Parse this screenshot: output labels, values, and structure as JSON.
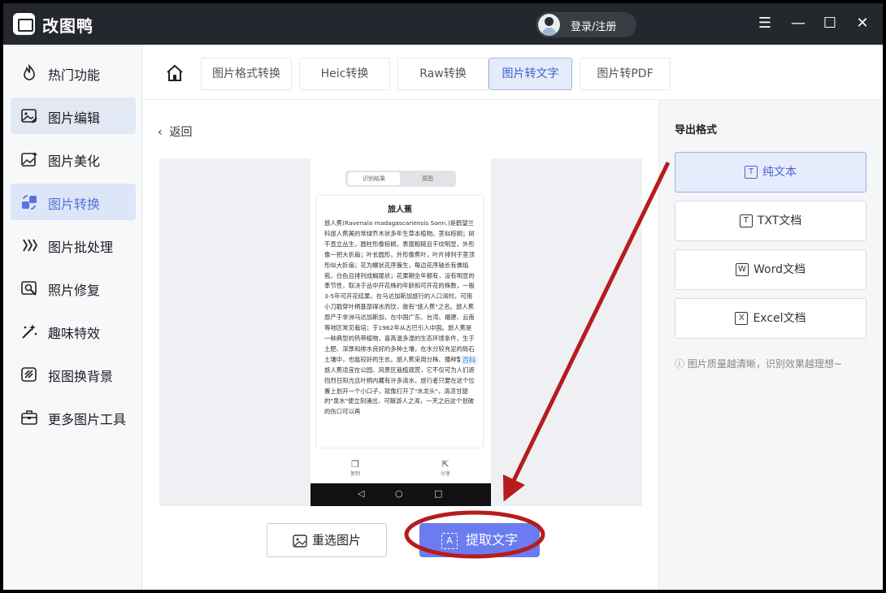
{
  "app": {
    "title": "改图鸭",
    "login_label": "登录/注册"
  },
  "window_controls": {
    "menu": "☰",
    "minimize": "—",
    "maximize": "☐",
    "close": "✕"
  },
  "sidebar": {
    "items": [
      {
        "label": "热门功能",
        "icon": "flame-icon"
      },
      {
        "label": "图片编辑",
        "icon": "image-edit-icon"
      },
      {
        "label": "图片美化",
        "icon": "image-beautify-icon"
      },
      {
        "label": "图片转换",
        "icon": "convert-icon"
      },
      {
        "label": "图片批处理",
        "icon": "batch-icon"
      },
      {
        "label": "照片修复",
        "icon": "repair-icon"
      },
      {
        "label": "趣味特效",
        "icon": "magic-wand-icon"
      },
      {
        "label": "抠图换背景",
        "icon": "cutout-icon"
      },
      {
        "label": "更多图片工具",
        "icon": "toolbox-icon"
      }
    ]
  },
  "tabs": [
    {
      "label": "图片格式转换"
    },
    {
      "label": "Heic转换"
    },
    {
      "label": "Raw转换"
    },
    {
      "label": "图片转文字",
      "active": true
    },
    {
      "label": "图片转PDF"
    }
  ],
  "main": {
    "back_label": "返回",
    "reselect_label": "重选图片",
    "extract_label": "提取文字",
    "extract_icon_text": "A"
  },
  "phone": {
    "tab_result": "识别结果",
    "tab_original": "原图",
    "doc_title": "旅人蕉",
    "doc_body": "旅人蕉(Ravenala madagascariensis Sonn.)是鹤望兰科旅人蕉属的常绿乔木状多年生草本植物。茎似棕榈；树干直立丛生，圆柱形像棕榈，表面粗糙且干纹明显，外形像一把大折扇；叶长圆形，外形像蕉叶，叶片排列于茎顶形似大折扇；花为螺状花序簇生，每边花序轴长有佛焰苞，白色且排列成蝎尾状；花果期全年都有，没有明显的季节性，取决于丛中开花株的年龄和可开花的株数，一般3-5年可开花结果。在马达加斯加旅行的人口渴时，可用小刀戳穿叶柄基部得水而饮，故有\"旅人蕉\"之名。旅人蕉原产于非洲马达加斯加，在中国广东、台湾、福建、云南等地区常见栽培；于1962年从古巴引入中国。旅人蕉是一种典型的热带植物，喜高温多湿的生态环境条件，生于土肥、深厚和排水良好的多种土壤，在水分较充足的砾石土壤中，也能较好的生长。旅人蕉采用分株、播种繁殖。旅人蕉适宜在公园、风景区栽植观赏，它不仅可为人们遮挡烈日阳光且叶柄内藏有许多清水，旅行者只要在这个位置上划开一个小口子，就像打开了\"水龙头\"，清凉甘甜的\"泉水\"便立刻涌出，可解游人之渴，一天之后这个划破的伤口可以再",
    "baike_label": "百科",
    "bottom_copy": "复制",
    "bottom_share": "分享",
    "nav_back": "◁",
    "nav_home": "○",
    "nav_recent": "□"
  },
  "export": {
    "title": "导出格式",
    "formats": [
      {
        "label": "纯文本",
        "icon": "T",
        "active": true
      },
      {
        "label": "TXT文档",
        "icon": "T"
      },
      {
        "label": "Word文档",
        "icon": "W"
      },
      {
        "label": "Excel文档",
        "icon": "X"
      }
    ],
    "tip": "ⓘ 图片质量越清晰，识别效果越理想~"
  },
  "colors": {
    "accent": "#6a7cf0",
    "annotation": "#b71c1c",
    "titlebar": "#24272d"
  }
}
